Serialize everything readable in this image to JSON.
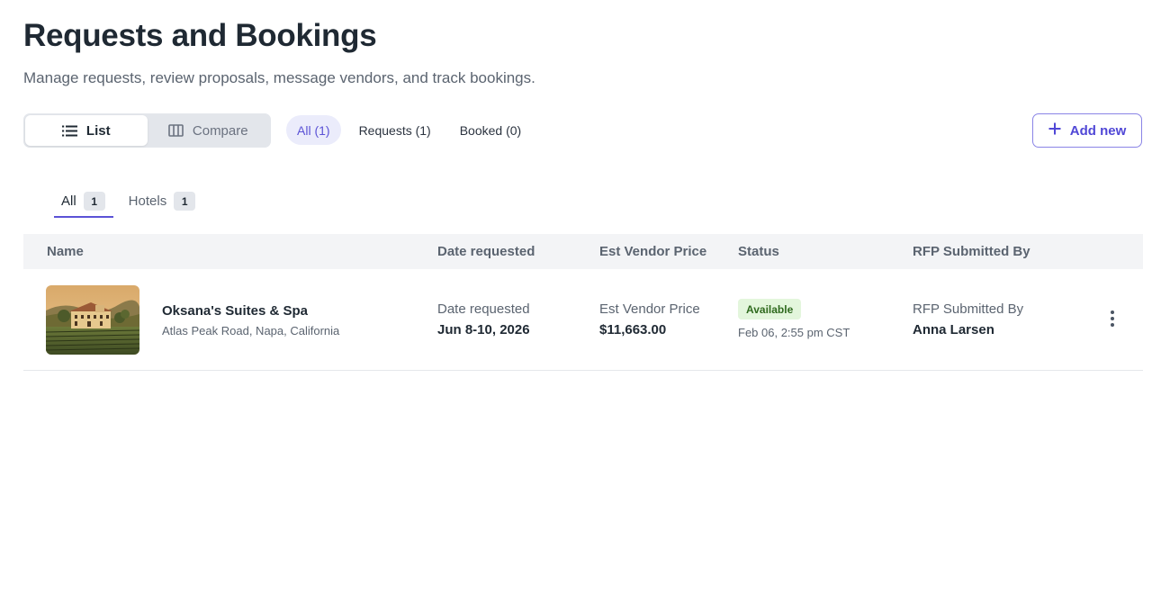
{
  "header": {
    "title": "Requests and Bookings",
    "subtitle": "Manage requests, review proposals, message vendors, and track bookings."
  },
  "view_toggle": {
    "list_label": "List",
    "compare_label": "Compare",
    "selected": "List"
  },
  "filters": {
    "all_label": "All (1)",
    "requests_label": "Requests (1)",
    "booked_label": "Booked (0)",
    "selected": "All (1)"
  },
  "add_new_label": "Add new",
  "tabs": [
    {
      "label": "All",
      "count": "1"
    },
    {
      "label": "Hotels",
      "count": "1"
    }
  ],
  "table": {
    "columns": {
      "name": "Name",
      "date_requested": "Date requested",
      "est_vendor_price": "Est Vendor Price",
      "status": "Status",
      "rfp_submitted_by": "RFP Submitted By"
    },
    "rows": [
      {
        "name": "Oksana's Suites & Spa",
        "address": "Atlas Peak Road, Napa, California",
        "date_label": "Date requested",
        "date_value": "Jun 8-10, 2026",
        "price_label": "Est Vendor Price",
        "price_value": "$11,663.00",
        "status": "Available",
        "status_time": "Feb 06, 2:55 pm CST",
        "rfp_label": "RFP Submitted By",
        "rfp_value": "Anna Larsen"
      }
    ]
  },
  "colors": {
    "accent": "#5b52d6",
    "status_available_bg": "#e3f6dc",
    "status_available_text": "#2f6a1e"
  },
  "icons": {
    "list": "list-icon",
    "compare": "columns-icon",
    "add": "plus-icon",
    "more": "kebab-icon"
  }
}
